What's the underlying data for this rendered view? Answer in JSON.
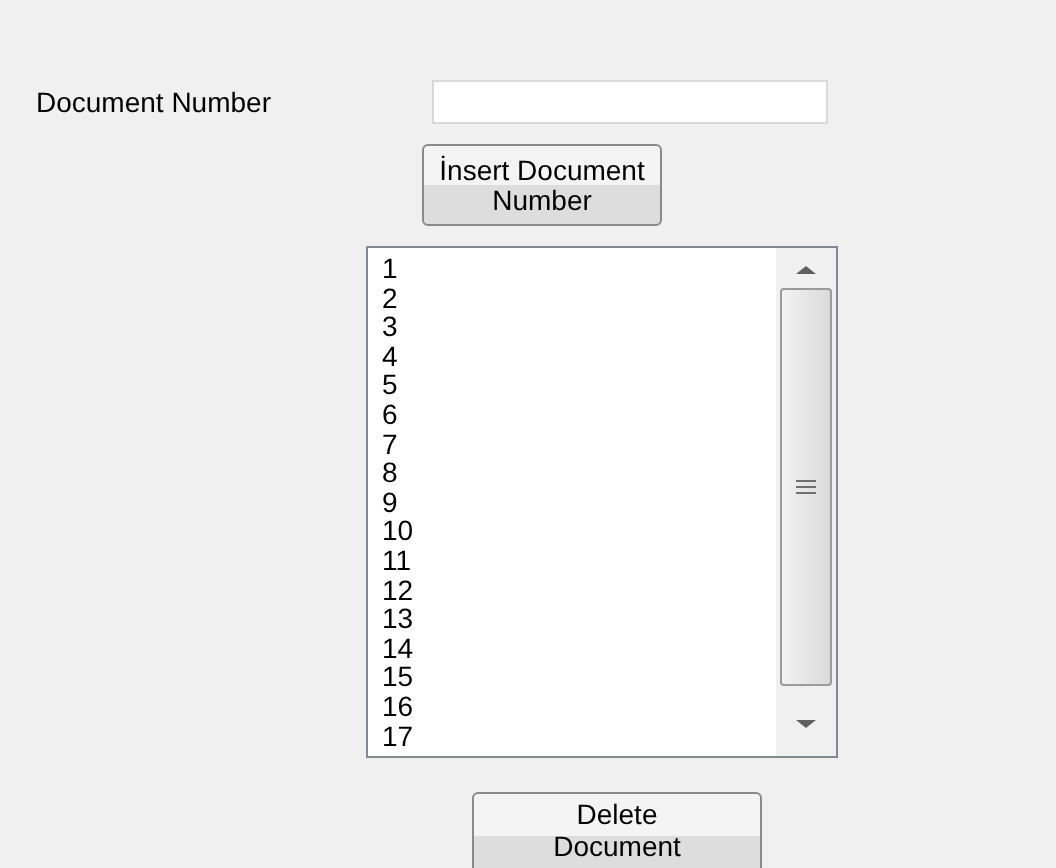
{
  "document_number": {
    "label": "Document Number"
  },
  "insert_button": "İnsert Document Number",
  "list": [
    "1",
    "2",
    "3",
    "4",
    "5",
    "6",
    "7",
    "8",
    "9",
    "10",
    "11",
    "12",
    "13",
    "14",
    "15",
    "16",
    "17"
  ],
  "delete_button": "Delete Document"
}
